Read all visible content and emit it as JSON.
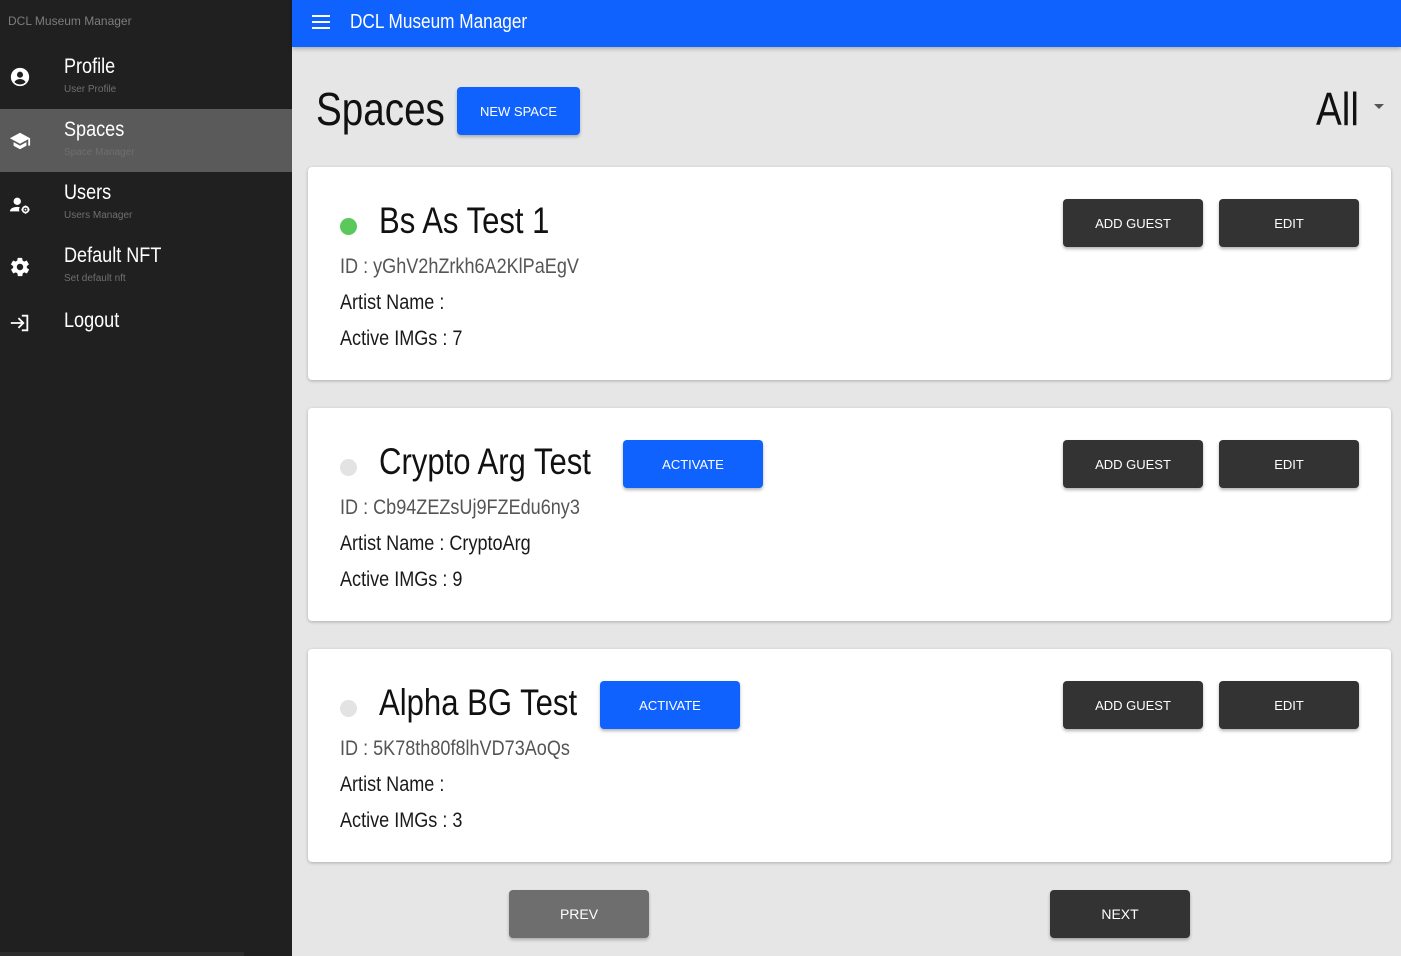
{
  "app": {
    "title": "DCL Museum Manager"
  },
  "sidebar": {
    "app_title": "DCL Museum Manager",
    "items": [
      {
        "label": "Profile",
        "sub": "User Profile",
        "icon": "account-circle-icon"
      },
      {
        "label": "Spaces",
        "sub": "Space Manager",
        "icon": "school-cap-icon",
        "active": true
      },
      {
        "label": "Users",
        "sub": "Users Manager",
        "icon": "manage-accounts-icon"
      },
      {
        "label": "Default NFT",
        "sub": "Set default nft",
        "icon": "gear-icon"
      },
      {
        "label": "Logout",
        "sub": "",
        "icon": "logout-icon"
      }
    ]
  },
  "header": {
    "title": "Spaces",
    "new_space_label": "NEW SPACE",
    "filter_value": "All"
  },
  "spaces": [
    {
      "name": "Bs As Test 1",
      "active": true,
      "status_color": "#5ac85a",
      "id_line": "ID : yGhV2hZrkh6A2KlPaEgV",
      "artist_line": "Artist Name :",
      "imgs_line": "Active IMGs : 7",
      "activate_label": "",
      "add_guest_label": "ADD GUEST",
      "edit_label": "EDIT"
    },
    {
      "name": "Crypto Arg Test",
      "active": false,
      "status_color": "#e3e3e3",
      "id_line": "ID : Cb94ZEZsUj9FZEdu6ny3",
      "artist_line": "Artist Name : CryptoArg",
      "imgs_line": "Active IMGs : 9",
      "activate_label": "ACTIVATE",
      "add_guest_label": "ADD GUEST",
      "edit_label": "EDIT"
    },
    {
      "name": "Alpha BG Test",
      "active": false,
      "status_color": "#e3e3e3",
      "id_line": "ID : 5K78th80f8lhVD73AoQs",
      "artist_line": "Artist Name :",
      "imgs_line": "Active IMGs : 3",
      "activate_label": "ACTIVATE",
      "add_guest_label": "ADD GUEST",
      "edit_label": "EDIT"
    }
  ],
  "pagination": {
    "prev_label": "PREV",
    "next_label": "NEXT"
  },
  "colors": {
    "primary": "#0f62fe",
    "sidebar_bg": "#202020",
    "sidebar_active": "#5a5a5a",
    "button_dark": "#333333",
    "button_disabled": "#6e6e6e"
  }
}
